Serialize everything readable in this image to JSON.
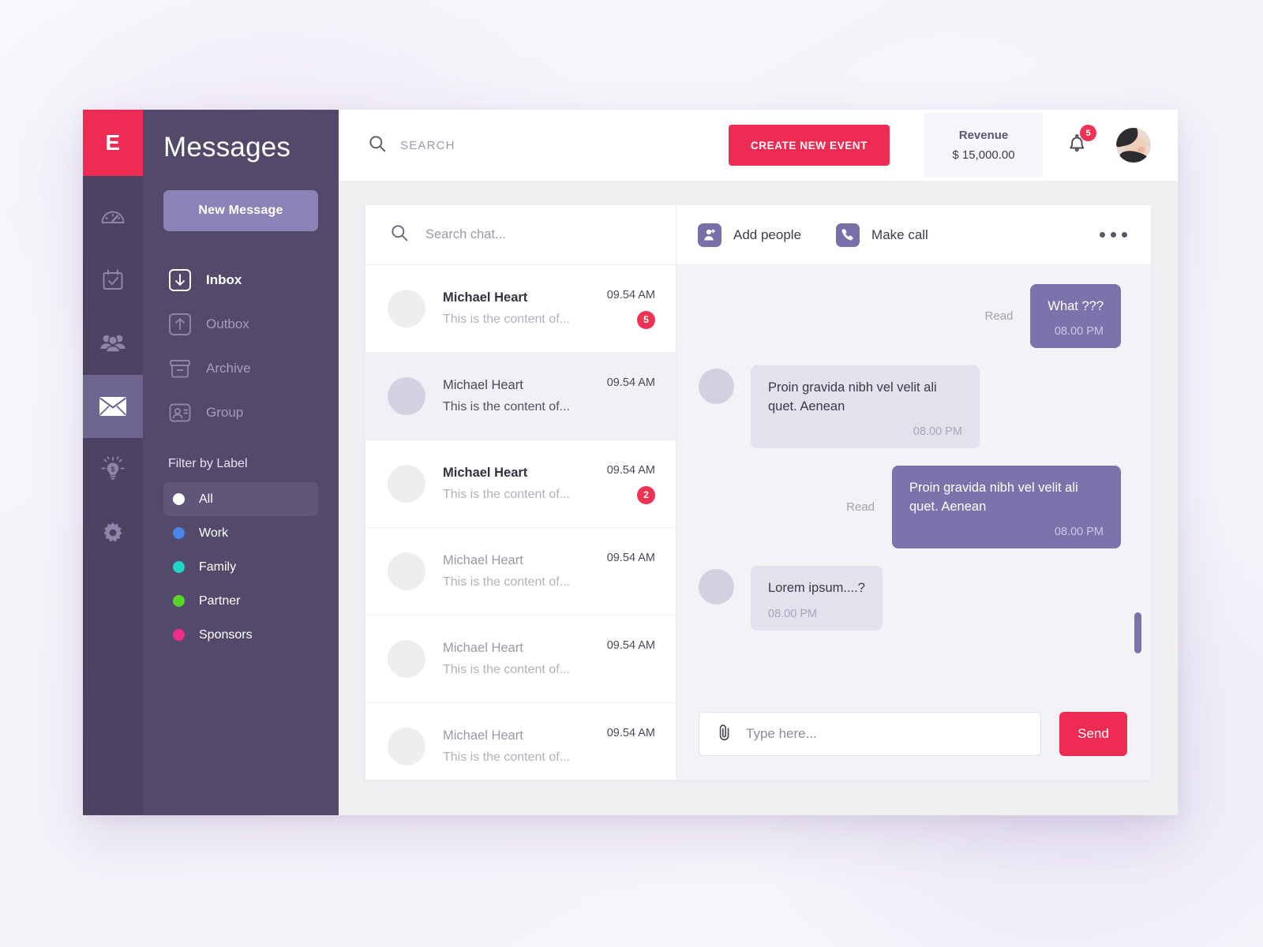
{
  "brand": {
    "logo_letter": "E",
    "accent_red": "#ee2b52",
    "accent_purple": "#7d72ab",
    "sidebar_bg": "#534a6b",
    "rail_bg": "#4b4361"
  },
  "rail": {
    "items": [
      {
        "icon": "dashboard-gauge-icon",
        "active": false
      },
      {
        "icon": "calendar-check-icon",
        "active": false
      },
      {
        "icon": "people-group-icon",
        "active": false
      },
      {
        "icon": "envelope-icon",
        "active": true
      },
      {
        "icon": "lightbulb-dollar-icon",
        "active": false
      },
      {
        "icon": "gear-icon",
        "active": false
      }
    ]
  },
  "sidebar": {
    "title": "Messages",
    "new_message_label": "New Message",
    "nav": [
      {
        "label": "Inbox",
        "icon": "arrow-down-box-icon",
        "active": true
      },
      {
        "label": "Outbox",
        "icon": "arrow-up-box-icon",
        "active": false
      },
      {
        "label": "Archive",
        "icon": "archive-box-icon",
        "active": false
      },
      {
        "label": "Group",
        "icon": "group-card-icon",
        "active": false
      }
    ],
    "filter_title": "Filter by Label",
    "labels": [
      {
        "label": "All",
        "color": "#ffffff",
        "active": true
      },
      {
        "label": "Work",
        "color": "#4a86e8",
        "active": false
      },
      {
        "label": "Family",
        "color": "#20d5c8",
        "active": false
      },
      {
        "label": "Partner",
        "color": "#57d62a",
        "active": false
      },
      {
        "label": "Sponsors",
        "color": "#ef2d86",
        "active": false
      }
    ]
  },
  "topbar": {
    "search_placeholder": "SEARCH",
    "create_event_label": "CREATE NEW EVENT",
    "revenue_label": "Revenue",
    "revenue_value": "$ 15,000.00",
    "notification_count": "5"
  },
  "chat_list": {
    "search_placeholder": "Search chat...",
    "rows": [
      {
        "name": "Michael Heart",
        "preview": "This is the content of...",
        "time": "09.54 AM",
        "badge": "5",
        "unread": true,
        "selected": false
      },
      {
        "name": "Michael Heart",
        "preview": "This is the content of...",
        "time": "09.54 AM",
        "badge": "",
        "unread": false,
        "selected": true
      },
      {
        "name": "Michael Heart",
        "preview": "This is the content of...",
        "time": "09.54 AM",
        "badge": "2",
        "unread": true,
        "selected": false
      },
      {
        "name": "Michael Heart",
        "preview": "This is the content of...",
        "time": "09.54 AM",
        "badge": "",
        "unread": false,
        "selected": false
      },
      {
        "name": "Michael Heart",
        "preview": "This is the content of...",
        "time": "09.54 AM",
        "badge": "",
        "unread": false,
        "selected": false
      },
      {
        "name": "Michael Heart",
        "preview": "This is the content of...",
        "time": "09.54 AM",
        "badge": "",
        "unread": false,
        "selected": false
      }
    ]
  },
  "conversation": {
    "add_people_label": "Add people",
    "make_call_label": "Make call",
    "more_menu": "more-options",
    "messages": [
      {
        "dir": "out",
        "status": "Read",
        "text": "What ???",
        "time": "08.00 PM"
      },
      {
        "dir": "in",
        "status": "",
        "text": "Proin gravida nibh vel velit ali quet. Aenean",
        "time": "08.00 PM"
      },
      {
        "dir": "out",
        "status": "Read",
        "text": "Proin gravida nibh vel velit ali quet. Aenean",
        "time": "08.00 PM"
      },
      {
        "dir": "in",
        "status": "",
        "text": "Lorem ipsum....?",
        "time": "08.00 PM"
      }
    ],
    "composer": {
      "placeholder": "Type here...",
      "send_label": "Send",
      "attach_icon": "paperclip-icon"
    }
  }
}
